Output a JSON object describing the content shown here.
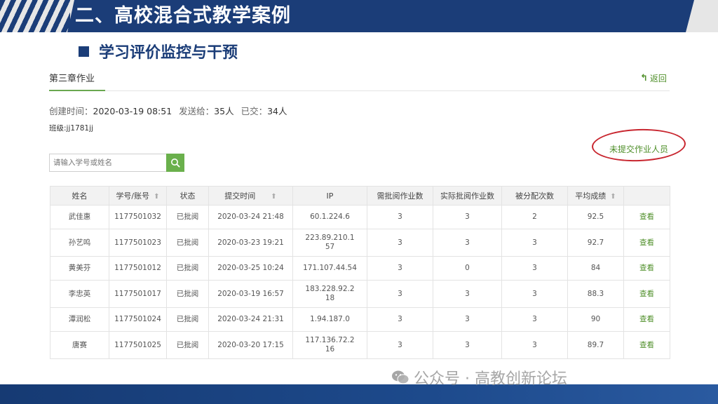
{
  "slide": {
    "title": "二、高校混合式教学案例",
    "subheading": "学习评价监控与干预"
  },
  "homework": {
    "title": "第三章作业",
    "back_label": "返回",
    "created_label": "创建时间：",
    "created_value": "2020-03-19 08:51",
    "sent_label": "发送给：",
    "sent_value": "35人",
    "submitted_label": "已交：",
    "submitted_value": "34人",
    "class_line": "班级:jj1781jj",
    "unsubmitted_link": "未提交作业人员",
    "search_placeholder": "请输入学号或姓名"
  },
  "table": {
    "headers": [
      "姓名",
      "学号/账号",
      "状态",
      "提交时间",
      "IP",
      "需批阅作业数",
      "实际批阅作业数",
      "被分配次数",
      "平均成绩",
      ""
    ],
    "rows": [
      {
        "name": "武佳惠",
        "id": "1177501032",
        "status": "已批阅",
        "time": "2020-03-24 21:48",
        "ip": "60.1.224.6",
        "need": "3",
        "actual": "3",
        "assigned": "2",
        "avg": "92.5",
        "action": "查看"
      },
      {
        "name": "孙艺鸣",
        "id": "1177501023",
        "status": "已批阅",
        "time": "2020-03-23 19:21",
        "ip": "223.89.210.157",
        "need": "3",
        "actual": "3",
        "assigned": "3",
        "avg": "92.7",
        "action": "查看"
      },
      {
        "name": "黄美芬",
        "id": "1177501012",
        "status": "已批阅",
        "time": "2020-03-25 10:24",
        "ip": "171.107.44.54",
        "need": "3",
        "actual": "0",
        "assigned": "3",
        "avg": "84",
        "action": "查看"
      },
      {
        "name": "李忠英",
        "id": "1177501017",
        "status": "已批阅",
        "time": "2020-03-19 16:57",
        "ip": "183.228.92.218",
        "need": "3",
        "actual": "3",
        "assigned": "3",
        "avg": "88.3",
        "action": "查看"
      },
      {
        "name": "潭润松",
        "id": "1177501024",
        "status": "已批阅",
        "time": "2020-03-24 21:31",
        "ip": "1.94.187.0",
        "need": "3",
        "actual": "3",
        "assigned": "3",
        "avg": "90",
        "action": "查看"
      },
      {
        "name": "唐赛",
        "id": "1177501025",
        "status": "已批阅",
        "time": "2020-03-20 17:15",
        "ip": "117.136.72.216",
        "need": "3",
        "actual": "3",
        "assigned": "3",
        "avg": "89.7",
        "action": "查看"
      }
    ]
  },
  "watermark": {
    "text": "公众号 · 高教创新论坛",
    "icon": "wechat-icon"
  },
  "colors": {
    "brand_navy": "#1b3d78",
    "link_green": "#4f8f2a",
    "highlight_red": "#c8262f"
  }
}
